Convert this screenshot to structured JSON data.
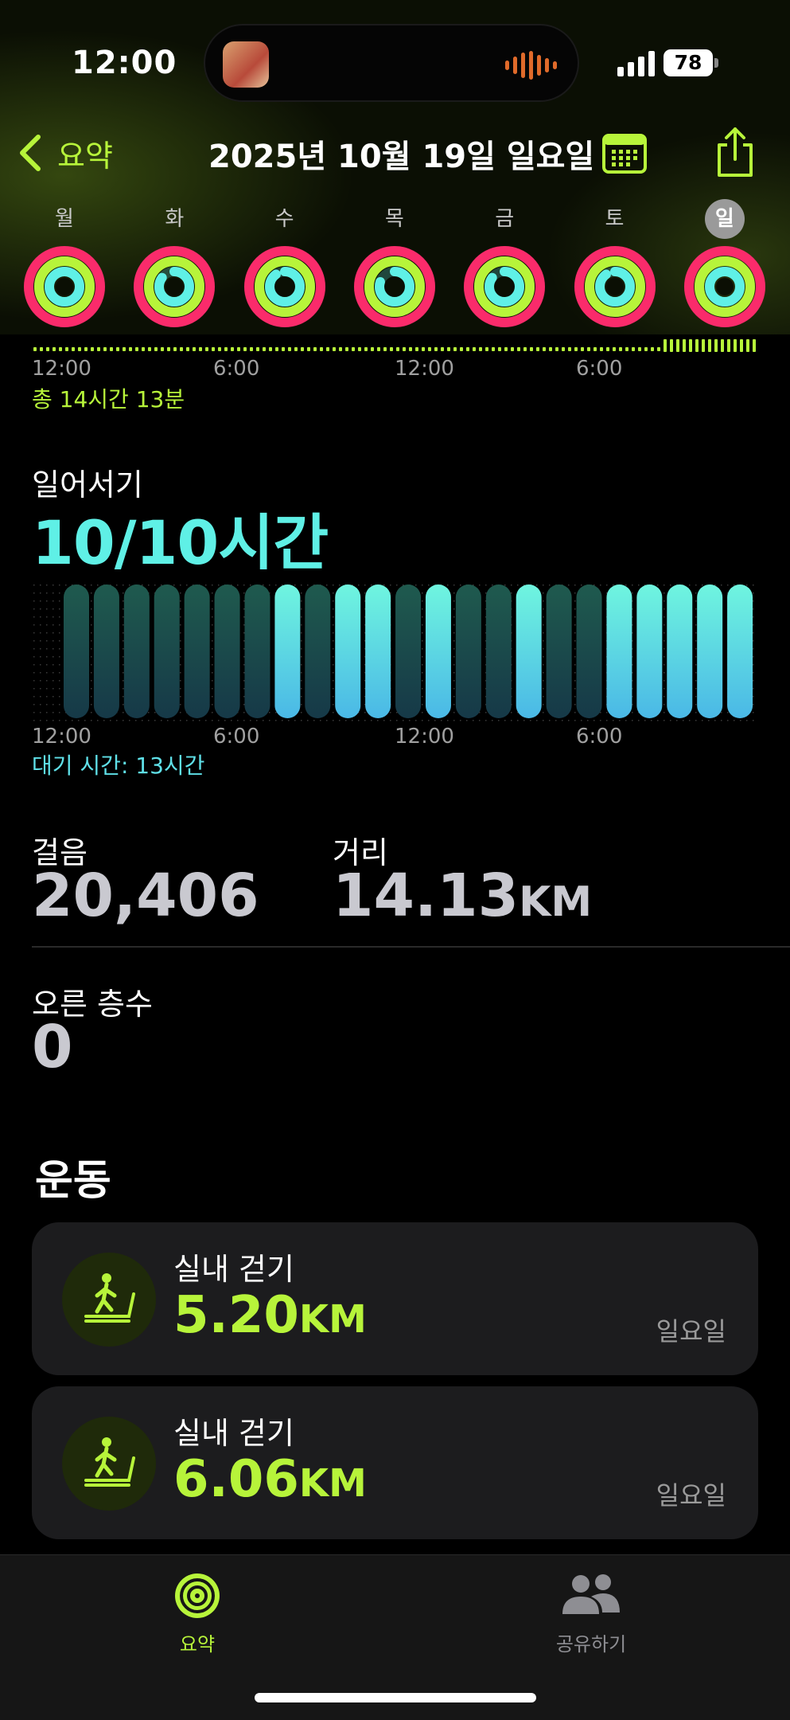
{
  "status": {
    "time": "12:00",
    "battery": "78"
  },
  "nav": {
    "back_label": "요약",
    "title": "2025년 10월 19일 일요일"
  },
  "week": [
    {
      "label": "월",
      "today": false,
      "move": 1.0,
      "exercise": 1.0,
      "stand": 1.0
    },
    {
      "label": "화",
      "today": false,
      "move": 1.0,
      "exercise": 1.0,
      "stand": 0.85
    },
    {
      "label": "수",
      "today": false,
      "move": 1.0,
      "exercise": 1.0,
      "stand": 0.9
    },
    {
      "label": "목",
      "today": false,
      "move": 1.0,
      "exercise": 1.0,
      "stand": 0.8
    },
    {
      "label": "금",
      "today": false,
      "move": 1.0,
      "exercise": 1.0,
      "stand": 0.85
    },
    {
      "label": "토",
      "today": false,
      "move": 1.0,
      "exercise": 1.0,
      "stand": 0.9
    },
    {
      "label": "일",
      "today": true,
      "move": 1.0,
      "exercise": 1.0,
      "stand": 1.0
    }
  ],
  "colors": {
    "move": "#fa2b6b",
    "exercise": "#b7f43a",
    "stand": "#5ff0e6",
    "accent": "#b7f43a"
  },
  "axis_labels": [
    "12:00",
    "6:00",
    "12:00",
    "6:00"
  ],
  "move_section": {
    "total": "총 14시간 13분"
  },
  "stand": {
    "title": "일어서기",
    "value": "10/10시간",
    "idle": "대기 시간: 13시간",
    "hours": [
      0,
      0,
      0,
      0,
      0,
      0,
      0,
      1,
      0,
      1,
      1,
      0,
      1,
      0,
      0,
      1,
      0,
      0,
      1,
      1,
      1,
      1,
      1
    ]
  },
  "stats": {
    "steps_label": "걸음",
    "steps_value": "20,406",
    "distance_label": "거리",
    "distance_value": "14.13",
    "distance_unit": "KM",
    "floors_label": "오른 층수",
    "floors_value": "0"
  },
  "workouts": {
    "title": "운동",
    "items": [
      {
        "name": "실내 걷기",
        "distance": "5.20",
        "unit": "KM",
        "day": "일요일"
      },
      {
        "name": "실내 걷기",
        "distance": "6.06",
        "unit": "KM",
        "day": "일요일"
      }
    ]
  },
  "tabs": {
    "summary": "요약",
    "sharing": "공유하기"
  }
}
